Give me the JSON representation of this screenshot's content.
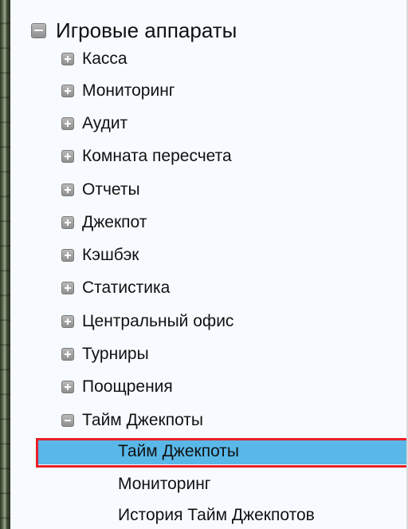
{
  "tree": {
    "root": {
      "label": "Игровые аппараты",
      "state": "expanded"
    },
    "items": [
      {
        "label": "Касса",
        "state": "collapsed"
      },
      {
        "label": "Мониторинг",
        "state": "collapsed"
      },
      {
        "label": "Аудит",
        "state": "collapsed"
      },
      {
        "label": "Комната пересчета",
        "state": "collapsed"
      },
      {
        "label": "Отчеты",
        "state": "collapsed"
      },
      {
        "label": "Джекпот",
        "state": "collapsed"
      },
      {
        "label": "Кэшбэк",
        "state": "collapsed"
      },
      {
        "label": "Статистика",
        "state": "collapsed"
      },
      {
        "label": "Центральный офис",
        "state": "collapsed"
      },
      {
        "label": "Турниры",
        "state": "collapsed"
      },
      {
        "label": "Поощрения",
        "state": "collapsed"
      },
      {
        "label": "Тайм Джекпоты",
        "state": "expanded"
      }
    ],
    "subitems": [
      {
        "label": "Тайм Джекпоты",
        "selected": true
      },
      {
        "label": "Мониторинг",
        "selected": false
      },
      {
        "label": "История Тайм Джекпотов",
        "selected": false
      }
    ]
  },
  "colors": {
    "selection": "#59b8e8",
    "highlight_frame": "#e8202a",
    "tree_background": "#f7fbff"
  },
  "icons": {
    "expanded": "minus-square-icon",
    "collapsed": "plus-square-icon"
  }
}
